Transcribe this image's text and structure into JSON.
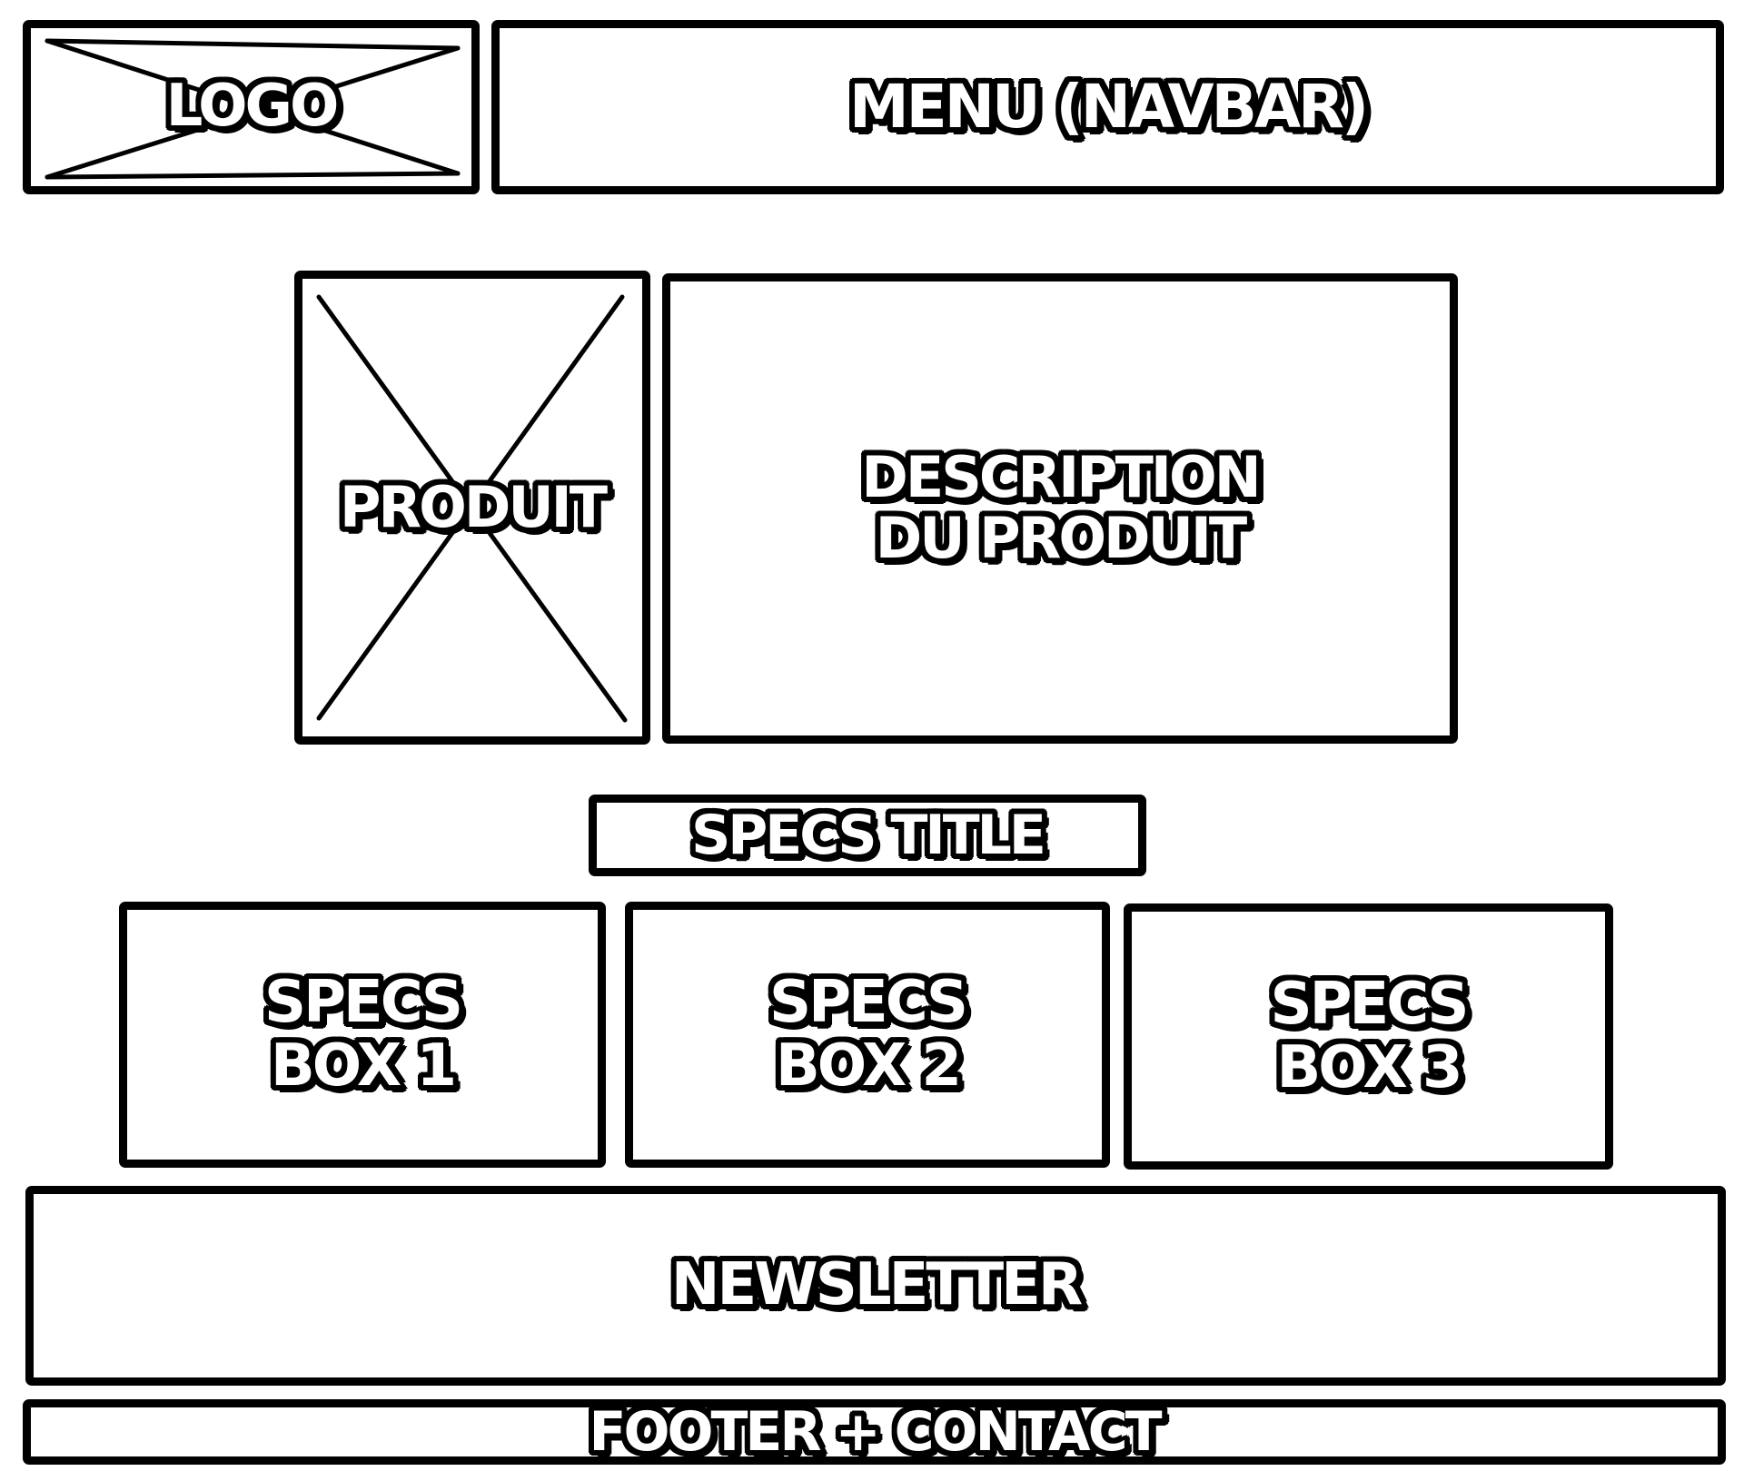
{
  "header": {
    "logo_label": "LOGO",
    "menu_label": "MENU (NAVBAR)"
  },
  "product": {
    "image_label": "PRODUIT",
    "description_label": "DESCRIPTION\nDU PRODUIT"
  },
  "specs": {
    "title_label": "SPECS TITLE",
    "boxes": [
      {
        "label": "SPECS\nBOX 1"
      },
      {
        "label": "SPECS\nBOX 2"
      },
      {
        "label": "SPECS\nBOX 3"
      }
    ]
  },
  "newsletter": {
    "label": "NEWSLETTER"
  },
  "footer": {
    "label": "FOOTER + CONTACT"
  },
  "colors": {
    "stroke": "#000000",
    "fill": "#ffffff"
  }
}
